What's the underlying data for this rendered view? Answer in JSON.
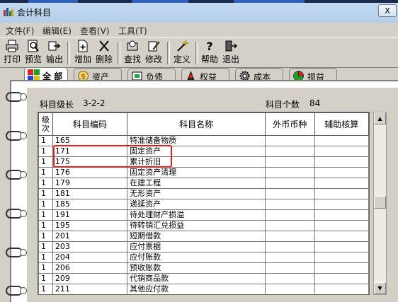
{
  "window": {
    "title": "会计科目",
    "close_glyph": "X"
  },
  "menu": [
    "文件(F)",
    "编辑(E)",
    "查看(V)",
    "工具(T)"
  ],
  "toolbar": {
    "print": "打印",
    "preview": "预览",
    "export": "输出",
    "add": "增加",
    "delete": "删除",
    "find": "查找",
    "modify": "修改",
    "define": "定义",
    "help": "帮助",
    "exit": "退出"
  },
  "tabs": [
    "全 部",
    "资产",
    "负债",
    "权益",
    "成本",
    "损益"
  ],
  "info": {
    "level_label": "科目级长",
    "level_value": "3-2-2",
    "count_label": "科目个数",
    "count_value": "84"
  },
  "table": {
    "columns": [
      "级次",
      "科目编码",
      "科目名称",
      "外币币种",
      "辅助核算"
    ],
    "rows": [
      [
        "1",
        "165",
        "特准储备物质",
        "",
        ""
      ],
      [
        "1",
        "171",
        "固定资产",
        "",
        ""
      ],
      [
        "1",
        "175",
        "累计折旧",
        "",
        ""
      ],
      [
        "1",
        "176",
        "固定资产清理",
        "",
        ""
      ],
      [
        "1",
        "179",
        "在建工程",
        "",
        ""
      ],
      [
        "1",
        "181",
        "无形资产",
        "",
        ""
      ],
      [
        "1",
        "185",
        "递延资产",
        "",
        ""
      ],
      [
        "1",
        "191",
        "待处理财产损溢",
        "",
        ""
      ],
      [
        "1",
        "195",
        "待转销汇兑损益",
        "",
        ""
      ],
      [
        "1",
        "201",
        "短期借款",
        "",
        ""
      ],
      [
        "1",
        "203",
        "应付票据",
        "",
        ""
      ],
      [
        "1",
        "204",
        "应付账款",
        "",
        ""
      ],
      [
        "1",
        "206",
        "预收账款",
        "",
        ""
      ],
      [
        "1",
        "209",
        "代销商品款",
        "",
        ""
      ],
      [
        "1",
        "211",
        "其他应付款",
        "",
        ""
      ]
    ]
  },
  "colors": {
    "highlight_box": "#e02020",
    "title_bar": "#c7dcf2"
  }
}
